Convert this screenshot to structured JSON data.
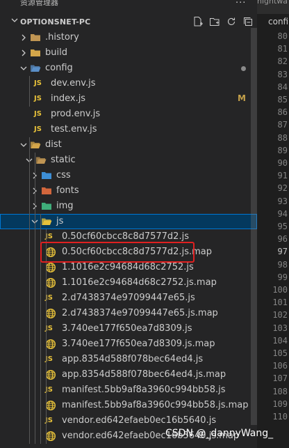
{
  "topbar": {
    "title": "资源管理器",
    "more": "...",
    "editor_tab_prev": "nightwa",
    "editor_tab_current": "confi"
  },
  "section": {
    "name": "OPTIONSNET-PC"
  },
  "tree": [
    {
      "label": ".history",
      "depth": 1,
      "kind": "folder",
      "icon": "folder-history-icon",
      "expanded": false
    },
    {
      "label": "build",
      "depth": 1,
      "kind": "folder",
      "icon": "folder-build-icon",
      "expanded": false
    },
    {
      "label": "config",
      "depth": 1,
      "kind": "folder",
      "icon": "folder-config-icon",
      "expanded": true,
      "decoration": "dot"
    },
    {
      "label": "dev.env.js",
      "depth": 2,
      "kind": "js",
      "icon": "js-file-icon"
    },
    {
      "label": "index.js",
      "depth": 2,
      "kind": "js",
      "icon": "js-file-icon",
      "badge": "M"
    },
    {
      "label": "prod.env.js",
      "depth": 2,
      "kind": "js",
      "icon": "js-file-icon"
    },
    {
      "label": "test.env.js",
      "depth": 2,
      "kind": "js",
      "icon": "js-file-icon"
    },
    {
      "label": "dist",
      "depth": 1,
      "kind": "folder",
      "icon": "folder-dist-icon",
      "expanded": true
    },
    {
      "label": "static",
      "depth": 2,
      "kind": "folder",
      "icon": "folder-static-icon",
      "expanded": true
    },
    {
      "label": "css",
      "depth": 3,
      "kind": "folder",
      "icon": "folder-css-icon",
      "expanded": false
    },
    {
      "label": "fonts",
      "depth": 3,
      "kind": "folder",
      "icon": "folder-fonts-icon",
      "expanded": false
    },
    {
      "label": "img",
      "depth": 3,
      "kind": "folder",
      "icon": "folder-img-icon",
      "expanded": false
    },
    {
      "label": "js",
      "depth": 3,
      "kind": "folder",
      "icon": "folder-js-icon",
      "expanded": true,
      "selected": true
    },
    {
      "label": "0.50cf60cbcc8c8d7577d2.js",
      "depth": 4,
      "kind": "js",
      "icon": "js-file-icon"
    },
    {
      "label": "0.50cf60cbcc8c8d7577d2.js.map",
      "depth": 4,
      "kind": "map",
      "icon": "map-file-icon",
      "highlighted": true
    },
    {
      "label": "1.1016e2c94684d68c2752.js",
      "depth": 4,
      "kind": "map",
      "icon": "map-file-icon"
    },
    {
      "label": "1.1016e2c94684d68c2752.js.map",
      "depth": 4,
      "kind": "map",
      "icon": "map-file-icon"
    },
    {
      "label": "2.d7438374e97099447e65.js",
      "depth": 4,
      "kind": "js",
      "icon": "js-file-icon"
    },
    {
      "label": "2.d7438374e97099447e65.js.map",
      "depth": 4,
      "kind": "map",
      "icon": "map-file-icon"
    },
    {
      "label": "3.740ee177f650ea7d8309.js",
      "depth": 4,
      "kind": "js",
      "icon": "js-file-icon"
    },
    {
      "label": "3.740ee177f650ea7d8309.js.map",
      "depth": 4,
      "kind": "map",
      "icon": "map-file-icon"
    },
    {
      "label": "app.8354d588f078bec64ed4.js",
      "depth": 4,
      "kind": "js",
      "icon": "js-file-icon"
    },
    {
      "label": "app.8354d588f078bec64ed4.js.map",
      "depth": 4,
      "kind": "map",
      "icon": "map-file-icon"
    },
    {
      "label": "manifest.5bb9af8a3960c994bb58.js",
      "depth": 4,
      "kind": "js",
      "icon": "js-file-icon"
    },
    {
      "label": "manifest.5bb9af8a3960c994bb58.js.map",
      "depth": 4,
      "kind": "map",
      "icon": "map-file-icon"
    },
    {
      "label": "vendor.ed642efaeb0ec16b5640.js",
      "depth": 4,
      "kind": "js",
      "icon": "js-file-icon"
    },
    {
      "label": "vendor.ed642efaeb0ec16b5640.js.map",
      "depth": 4,
      "kind": "map",
      "icon": "map-file-icon"
    }
  ],
  "line_numbers": [
    "80",
    "81",
    "82",
    "83",
    "84",
    "85",
    "86",
    "87",
    "88",
    "89",
    "90",
    "91",
    "92",
    "93",
    "94",
    "95",
    "96",
    "97",
    "98",
    "99",
    "100",
    "101",
    "102",
    "103",
    "104",
    "105",
    "106",
    "107",
    "108",
    "109",
    "110"
  ],
  "active_line": "97",
  "watermark": "CSDN @_dannyWang_",
  "colors": {
    "accent": "#0078d4",
    "highlight_box": "#e02020",
    "js_yellow": "#e8c23a",
    "folder_tan": "#c09553",
    "modified": "#c5a14a"
  }
}
